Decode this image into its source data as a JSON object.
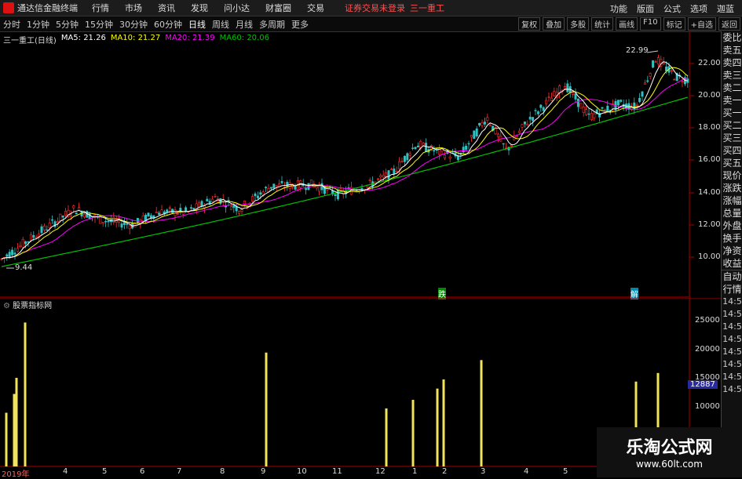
{
  "menubar": {
    "app_title": "通达信金融终端",
    "items": [
      "行情",
      "市场",
      "资讯",
      "发现",
      "问小达",
      "财富圈",
      "交易"
    ],
    "warning": "证券交易未登录",
    "stock_name": "三一重工",
    "right_items": [
      "功能",
      "版面",
      "公式",
      "选项"
    ],
    "skin": "迦蓝"
  },
  "toolbar": {
    "periods": [
      "分时",
      "1分钟",
      "5分钟",
      "15分钟",
      "30分钟",
      "60分钟",
      "日线",
      "周线",
      "月线",
      "多周期",
      "更多"
    ],
    "active_period": "日线",
    "right_buttons": [
      "复权",
      "叠加",
      "多股",
      "统计",
      "画线",
      "F10",
      "标记",
      "+自选",
      "返回"
    ]
  },
  "legend": {
    "stock": "三一重工(日线)",
    "ma5": "MA5: 21.26",
    "ma10": "MA10: 21.27",
    "ma20": "MA20: 21.39",
    "ma60": "MA60: 20.06"
  },
  "price_axis": [
    "22.00",
    "20.00",
    "18.00",
    "16.00",
    "14.00",
    "12.00",
    "10.00"
  ],
  "annotations": {
    "high": "22.99",
    "low": "9.44"
  },
  "indicator": {
    "title": "股票指标网",
    "axis": [
      "25000",
      "20000",
      "15000",
      "10000"
    ],
    "value_badge": "12887"
  },
  "side_panel": {
    "items": [
      "委比",
      "卖五",
      "卖四",
      "卖三",
      "卖二",
      "卖一",
      "买一",
      "买二",
      "买三",
      "买四",
      "买五",
      "现价",
      "涨跌",
      "涨幅",
      "总量",
      "外盘",
      "换手",
      "净资",
      "收益",
      "自动",
      "行情"
    ],
    "times": [
      "14:5",
      "14:5",
      "14:5",
      "14:5",
      "14:5",
      "14:5",
      "14:5",
      "14:5"
    ]
  },
  "markers": {
    "m1": "跌",
    "m2": "解"
  },
  "x_labels": [
    "2019年",
    "4",
    "5",
    "6",
    "7",
    "8",
    "9",
    "10",
    "11",
    "12",
    "1",
    "2",
    "3",
    "4",
    "5"
  ],
  "watermark": {
    "main": "乐淘公式网",
    "sub": "www.60lt.com"
  },
  "colors": {
    "ma5": "#ffffff",
    "ma10": "#ffff00",
    "ma20": "#ff00ff",
    "ma60": "#00c000",
    "vol_bar": "#f2e45a",
    "up": "#ff3030",
    "down": "#30c0c0"
  }
}
